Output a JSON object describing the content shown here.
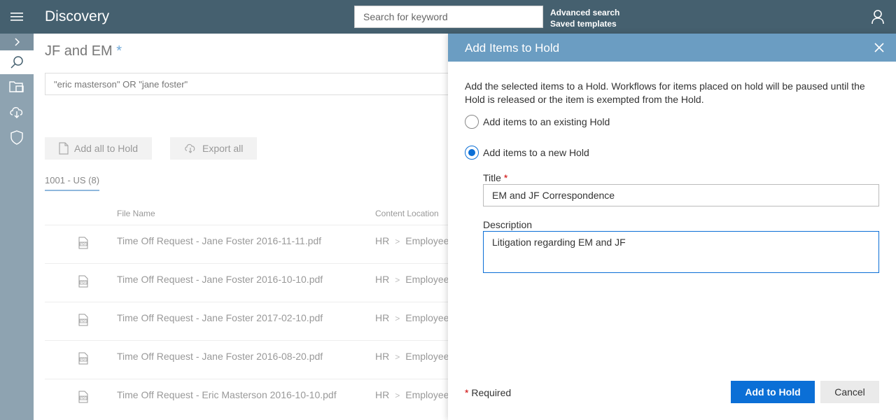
{
  "app": {
    "title": "Discovery"
  },
  "search": {
    "placeholder": "Search for keyword"
  },
  "top_links": {
    "advanced": "Advanced search",
    "saved": "Saved templates"
  },
  "page": {
    "title": "JF and EM",
    "title_marker": "*",
    "query": "\"eric masterson\" OR \"jane foster\"",
    "add_all_label": "Add all to Hold",
    "export_all_label": "Export all",
    "tab_label": "1001 - US (8)",
    "col_file_name": "File Name",
    "col_content_location": "Content Location"
  },
  "rows": [
    {
      "file": "Time Off Request - Jane Foster 2016-11-11.pdf",
      "loc_root": "HR",
      "loc_child": "Employee"
    },
    {
      "file": "Time Off Request - Jane Foster 2016-10-10.pdf",
      "loc_root": "HR",
      "loc_child": "Employee"
    },
    {
      "file": "Time Off Request - Jane Foster 2017-02-10.pdf",
      "loc_root": "HR",
      "loc_child": "Employee"
    },
    {
      "file": "Time Off Request - Jane Foster 2016-08-20.pdf",
      "loc_root": "HR",
      "loc_child": "Employee"
    },
    {
      "file": "Time Off Request - Eric Masterson 2016-10-10.pdf",
      "loc_root": "HR",
      "loc_child": "Employee"
    }
  ],
  "panel": {
    "title": "Add Items to Hold",
    "description": "Add the selected items to a Hold. Workflows for items placed on hold will be paused until the Hold is released or the item is exempted from the Hold.",
    "option_existing": "Add items to an existing Hold",
    "option_new": "Add items to a new Hold",
    "title_label": "Title",
    "title_value": "EM and JF Correspondence",
    "description_label": "Description",
    "description_value": "Litigation regarding EM and JF",
    "required_marker": "*",
    "required_note": "Required",
    "add_button": "Add to Hold",
    "cancel_button": "Cancel"
  },
  "colors": {
    "topbar": "#45606f",
    "rail": "#8ea3b1",
    "panel_header": "#6b9dc2",
    "primary": "#0b6fd6"
  }
}
